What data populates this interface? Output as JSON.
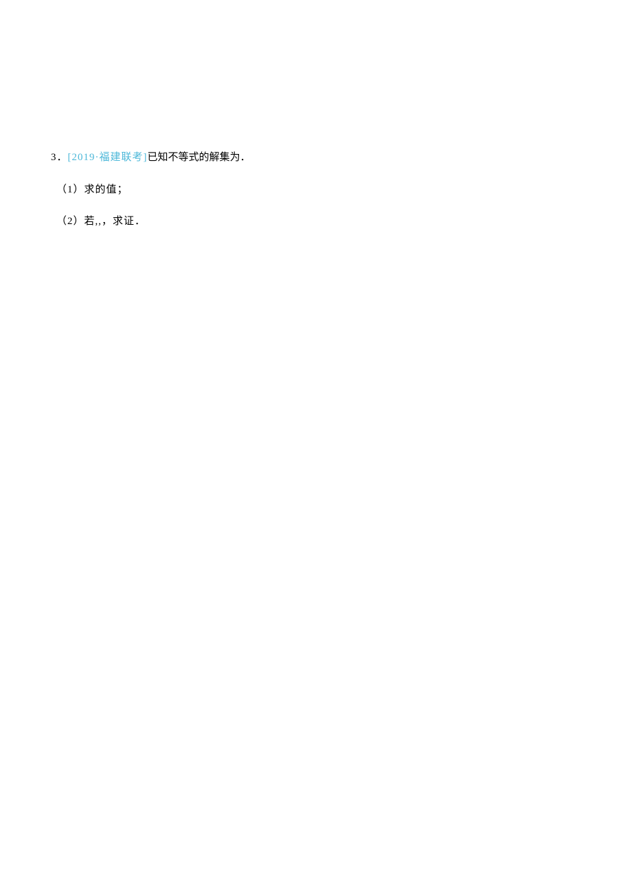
{
  "problem": {
    "number": "3．",
    "citation": "[2019·福建联考]",
    "statement": "已知不等式的解集为．",
    "parts": [
      {
        "label": "（1）",
        "text": "求的值；"
      },
      {
        "label": "（2）",
        "text": "若,,，求证．"
      }
    ]
  }
}
